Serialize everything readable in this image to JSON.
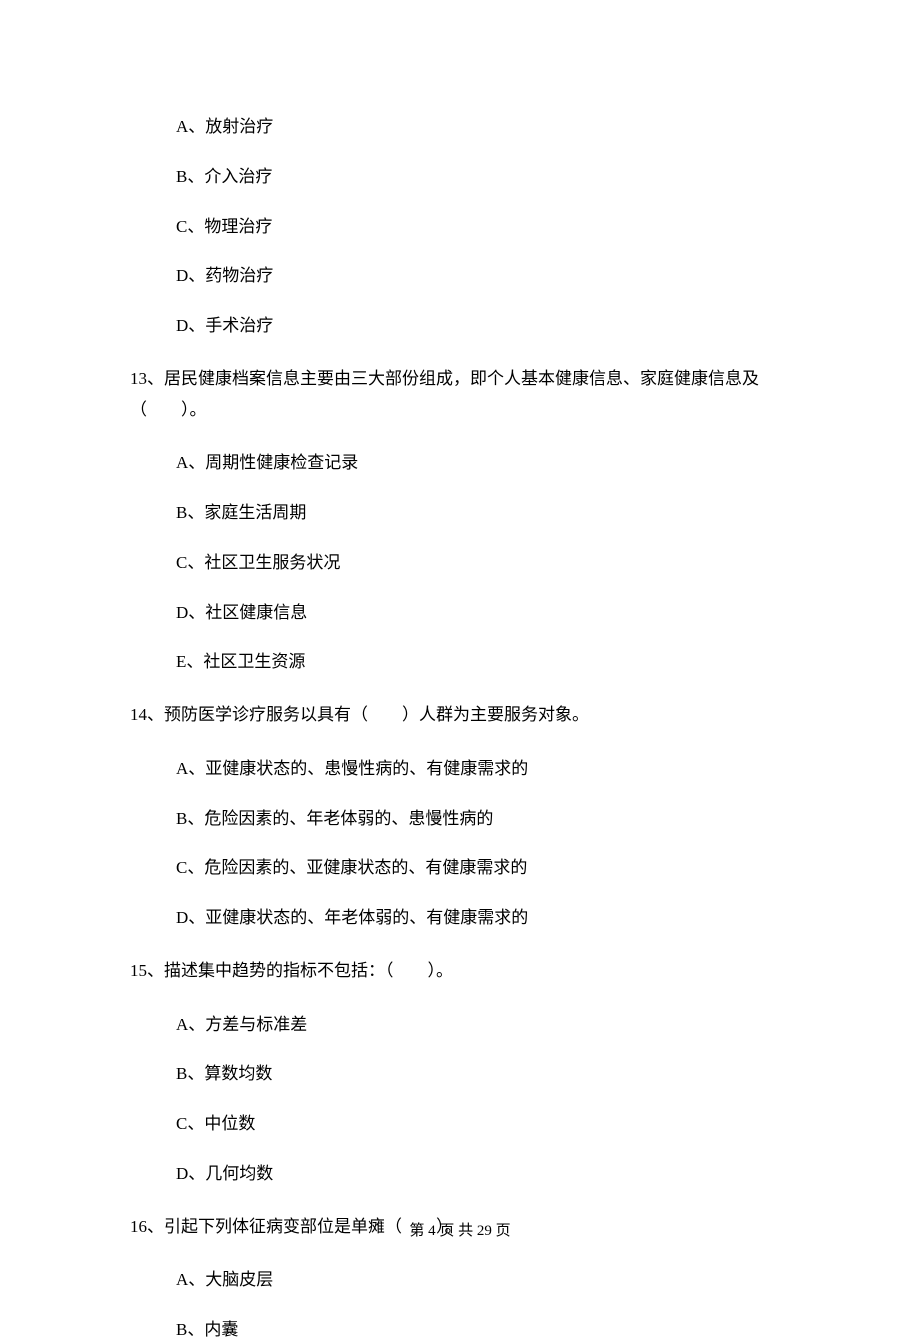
{
  "q12": {
    "options": {
      "a": "A、放射治疗",
      "b": "B、介入治疗",
      "c": "C、物理治疗",
      "d1": "D、药物治疗",
      "d2": "D、手术治疗"
    }
  },
  "q13": {
    "text": "13、居民健康档案信息主要由三大部份组成，即个人基本健康信息、家庭健康信息及（　　）。",
    "options": {
      "a": "A、周期性健康检查记录",
      "b": "B、家庭生活周期",
      "c": "C、社区卫生服务状况",
      "d": "D、社区健康信息",
      "e": "E、社区卫生资源"
    }
  },
  "q14": {
    "text": "14、预防医学诊疗服务以具有（　　）人群为主要服务对象。",
    "options": {
      "a": "A、亚健康状态的、患慢性病的、有健康需求的",
      "b": "B、危险因素的、年老体弱的、患慢性病的",
      "c": "C、危险因素的、亚健康状态的、有健康需求的",
      "d": "D、亚健康状态的、年老体弱的、有健康需求的"
    }
  },
  "q15": {
    "text": "15、描述集中趋势的指标不包括：（　　）。",
    "options": {
      "a": "A、方差与标准差",
      "b": "B、算数均数",
      "c": "C、中位数",
      "d": "D、几何均数"
    }
  },
  "q16": {
    "text": "16、引起下列体征病变部位是单瘫（　　）。",
    "options": {
      "a": "A、大脑皮层",
      "b": "B、内囊"
    }
  },
  "footer": "第 4 页 共 29 页"
}
